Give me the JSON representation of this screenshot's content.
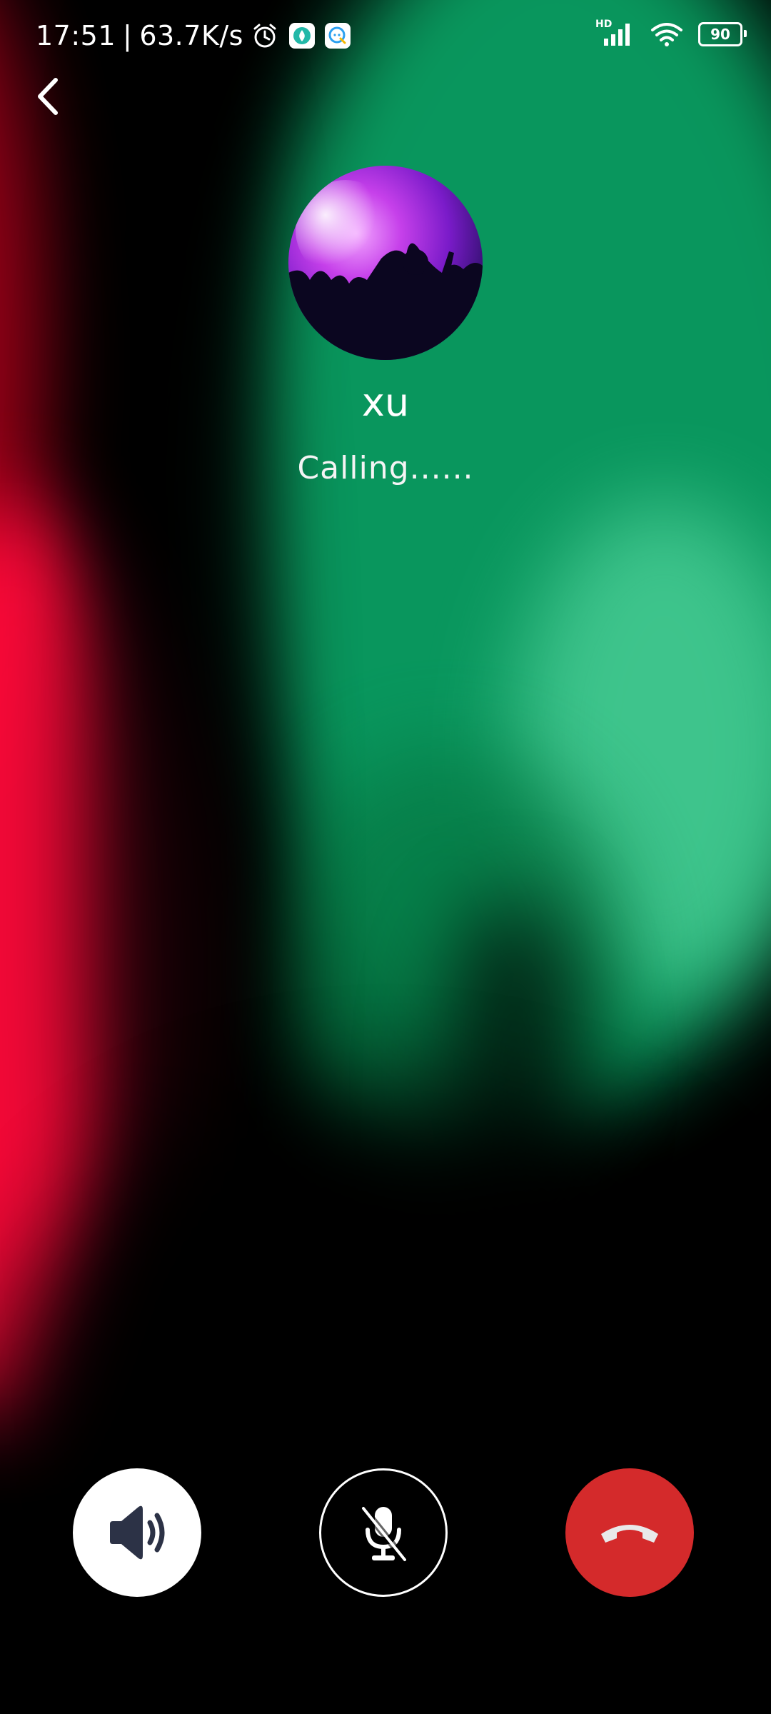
{
  "status_bar": {
    "time": "17:51",
    "separator": "|",
    "net_speed": "63.7K/s",
    "signal_label": "HD",
    "battery": "90",
    "icons": [
      "alarm-icon",
      "app-badge-icon",
      "chat-app-icon",
      "signal-icon",
      "wifi-icon",
      "battery-icon"
    ]
  },
  "call": {
    "contact_name": "xu",
    "status": "Calling......"
  },
  "controls": {
    "speaker_icon": "speaker-icon",
    "mute_icon": "microphone-off-icon",
    "hangup_icon": "phone-hangup-icon"
  },
  "colors": {
    "hangup": "#d42a2b",
    "speaker_bg": "#ffffff",
    "icon_dark": "#2c3246"
  }
}
